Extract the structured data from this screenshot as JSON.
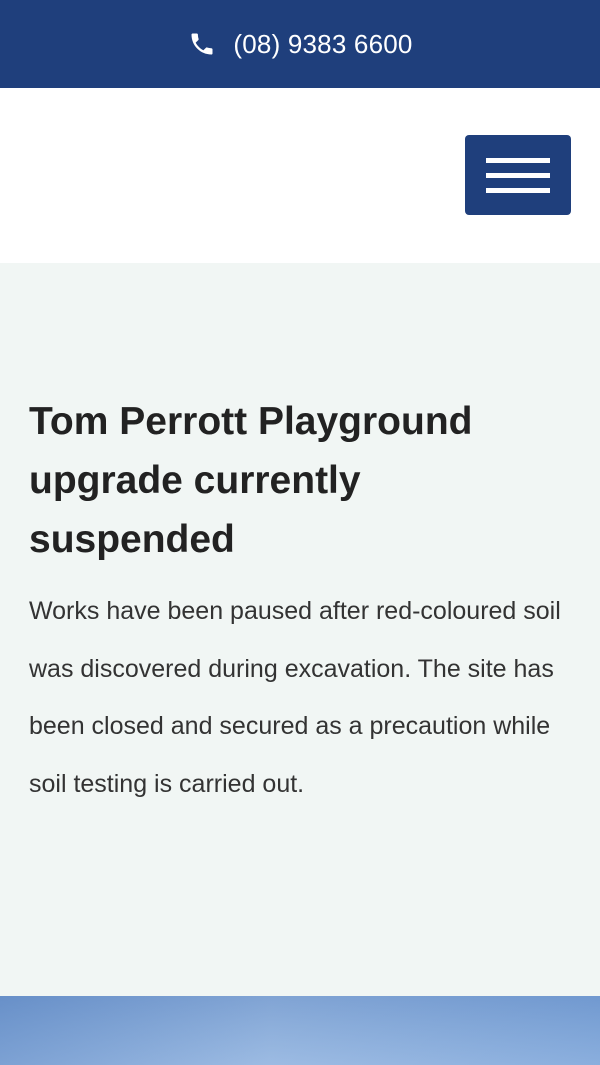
{
  "topbar": {
    "phone_number": "(08) 9383 6600",
    "icon": "phone-icon"
  },
  "header": {
    "menu_icon": "hamburger-icon"
  },
  "notice": {
    "title": "Tom Perrott Playground upgrade currently suspended",
    "body": "Works have been paused after red-coloured soil was discovered during excavation. The site has been closed and secured as a precaution while soil testing is carried out."
  },
  "colors": {
    "brand": "#1f3f7c",
    "notice_bg": "#f1f6f4"
  }
}
